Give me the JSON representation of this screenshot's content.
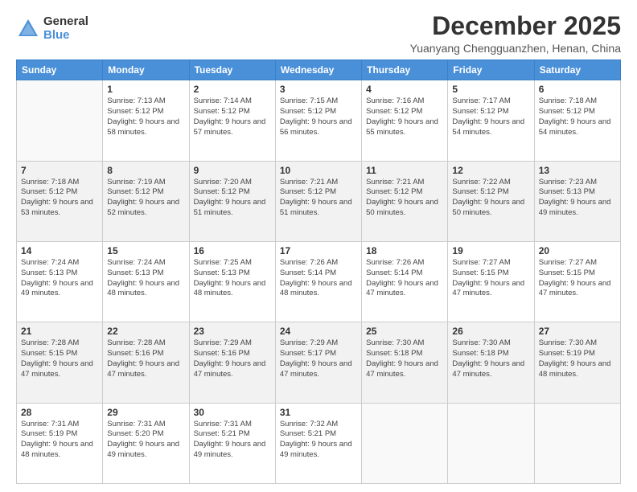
{
  "logo": {
    "general": "General",
    "blue": "Blue"
  },
  "title": {
    "month_year": "December 2025",
    "location": "Yuanyang Chengguanzhen, Henan, China"
  },
  "headers": [
    "Sunday",
    "Monday",
    "Tuesday",
    "Wednesday",
    "Thursday",
    "Friday",
    "Saturday"
  ],
  "weeks": [
    [
      {
        "day": "",
        "sunrise": "",
        "sunset": "",
        "daylight": ""
      },
      {
        "day": "1",
        "sunrise": "Sunrise: 7:13 AM",
        "sunset": "Sunset: 5:12 PM",
        "daylight": "Daylight: 9 hours and 58 minutes."
      },
      {
        "day": "2",
        "sunrise": "Sunrise: 7:14 AM",
        "sunset": "Sunset: 5:12 PM",
        "daylight": "Daylight: 9 hours and 57 minutes."
      },
      {
        "day": "3",
        "sunrise": "Sunrise: 7:15 AM",
        "sunset": "Sunset: 5:12 PM",
        "daylight": "Daylight: 9 hours and 56 minutes."
      },
      {
        "day": "4",
        "sunrise": "Sunrise: 7:16 AM",
        "sunset": "Sunset: 5:12 PM",
        "daylight": "Daylight: 9 hours and 55 minutes."
      },
      {
        "day": "5",
        "sunrise": "Sunrise: 7:17 AM",
        "sunset": "Sunset: 5:12 PM",
        "daylight": "Daylight: 9 hours and 54 minutes."
      },
      {
        "day": "6",
        "sunrise": "Sunrise: 7:18 AM",
        "sunset": "Sunset: 5:12 PM",
        "daylight": "Daylight: 9 hours and 54 minutes."
      }
    ],
    [
      {
        "day": "7",
        "sunrise": "Sunrise: 7:18 AM",
        "sunset": "Sunset: 5:12 PM",
        "daylight": "Daylight: 9 hours and 53 minutes."
      },
      {
        "day": "8",
        "sunrise": "Sunrise: 7:19 AM",
        "sunset": "Sunset: 5:12 PM",
        "daylight": "Daylight: 9 hours and 52 minutes."
      },
      {
        "day": "9",
        "sunrise": "Sunrise: 7:20 AM",
        "sunset": "Sunset: 5:12 PM",
        "daylight": "Daylight: 9 hours and 51 minutes."
      },
      {
        "day": "10",
        "sunrise": "Sunrise: 7:21 AM",
        "sunset": "Sunset: 5:12 PM",
        "daylight": "Daylight: 9 hours and 51 minutes."
      },
      {
        "day": "11",
        "sunrise": "Sunrise: 7:21 AM",
        "sunset": "Sunset: 5:12 PM",
        "daylight": "Daylight: 9 hours and 50 minutes."
      },
      {
        "day": "12",
        "sunrise": "Sunrise: 7:22 AM",
        "sunset": "Sunset: 5:12 PM",
        "daylight": "Daylight: 9 hours and 50 minutes."
      },
      {
        "day": "13",
        "sunrise": "Sunrise: 7:23 AM",
        "sunset": "Sunset: 5:13 PM",
        "daylight": "Daylight: 9 hours and 49 minutes."
      }
    ],
    [
      {
        "day": "14",
        "sunrise": "Sunrise: 7:24 AM",
        "sunset": "Sunset: 5:13 PM",
        "daylight": "Daylight: 9 hours and 49 minutes."
      },
      {
        "day": "15",
        "sunrise": "Sunrise: 7:24 AM",
        "sunset": "Sunset: 5:13 PM",
        "daylight": "Daylight: 9 hours and 48 minutes."
      },
      {
        "day": "16",
        "sunrise": "Sunrise: 7:25 AM",
        "sunset": "Sunset: 5:13 PM",
        "daylight": "Daylight: 9 hours and 48 minutes."
      },
      {
        "day": "17",
        "sunrise": "Sunrise: 7:26 AM",
        "sunset": "Sunset: 5:14 PM",
        "daylight": "Daylight: 9 hours and 48 minutes."
      },
      {
        "day": "18",
        "sunrise": "Sunrise: 7:26 AM",
        "sunset": "Sunset: 5:14 PM",
        "daylight": "Daylight: 9 hours and 47 minutes."
      },
      {
        "day": "19",
        "sunrise": "Sunrise: 7:27 AM",
        "sunset": "Sunset: 5:15 PM",
        "daylight": "Daylight: 9 hours and 47 minutes."
      },
      {
        "day": "20",
        "sunrise": "Sunrise: 7:27 AM",
        "sunset": "Sunset: 5:15 PM",
        "daylight": "Daylight: 9 hours and 47 minutes."
      }
    ],
    [
      {
        "day": "21",
        "sunrise": "Sunrise: 7:28 AM",
        "sunset": "Sunset: 5:15 PM",
        "daylight": "Daylight: 9 hours and 47 minutes."
      },
      {
        "day": "22",
        "sunrise": "Sunrise: 7:28 AM",
        "sunset": "Sunset: 5:16 PM",
        "daylight": "Daylight: 9 hours and 47 minutes."
      },
      {
        "day": "23",
        "sunrise": "Sunrise: 7:29 AM",
        "sunset": "Sunset: 5:16 PM",
        "daylight": "Daylight: 9 hours and 47 minutes."
      },
      {
        "day": "24",
        "sunrise": "Sunrise: 7:29 AM",
        "sunset": "Sunset: 5:17 PM",
        "daylight": "Daylight: 9 hours and 47 minutes."
      },
      {
        "day": "25",
        "sunrise": "Sunrise: 7:30 AM",
        "sunset": "Sunset: 5:18 PM",
        "daylight": "Daylight: 9 hours and 47 minutes."
      },
      {
        "day": "26",
        "sunrise": "Sunrise: 7:30 AM",
        "sunset": "Sunset: 5:18 PM",
        "daylight": "Daylight: 9 hours and 47 minutes."
      },
      {
        "day": "27",
        "sunrise": "Sunrise: 7:30 AM",
        "sunset": "Sunset: 5:19 PM",
        "daylight": "Daylight: 9 hours and 48 minutes."
      }
    ],
    [
      {
        "day": "28",
        "sunrise": "Sunrise: 7:31 AM",
        "sunset": "Sunset: 5:19 PM",
        "daylight": "Daylight: 9 hours and 48 minutes."
      },
      {
        "day": "29",
        "sunrise": "Sunrise: 7:31 AM",
        "sunset": "Sunset: 5:20 PM",
        "daylight": "Daylight: 9 hours and 49 minutes."
      },
      {
        "day": "30",
        "sunrise": "Sunrise: 7:31 AM",
        "sunset": "Sunset: 5:21 PM",
        "daylight": "Daylight: 9 hours and 49 minutes."
      },
      {
        "day": "31",
        "sunrise": "Sunrise: 7:32 AM",
        "sunset": "Sunset: 5:21 PM",
        "daylight": "Daylight: 9 hours and 49 minutes."
      },
      {
        "day": "",
        "sunrise": "",
        "sunset": "",
        "daylight": ""
      },
      {
        "day": "",
        "sunrise": "",
        "sunset": "",
        "daylight": ""
      },
      {
        "day": "",
        "sunrise": "",
        "sunset": "",
        "daylight": ""
      }
    ]
  ]
}
